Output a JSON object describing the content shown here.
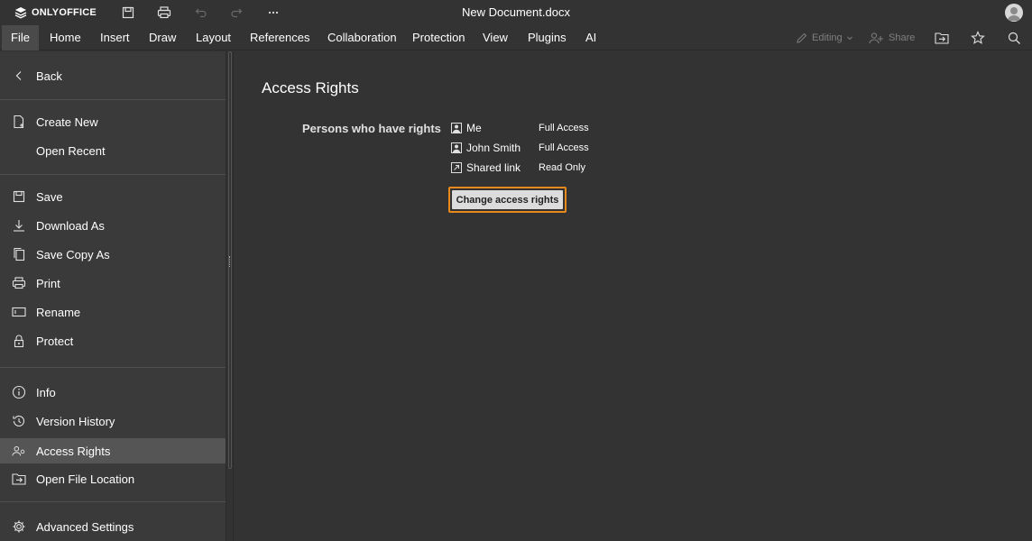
{
  "app": {
    "brand": "ONLYOFFICE",
    "document_title": "New Document.docx"
  },
  "menu_tabs": [
    {
      "label": "File",
      "active": true
    },
    {
      "label": "Home"
    },
    {
      "label": "Insert"
    },
    {
      "label": "Draw"
    },
    {
      "label": "Layout"
    },
    {
      "label": "References"
    },
    {
      "label": "Collaboration"
    },
    {
      "label": "Protection"
    },
    {
      "label": "View"
    },
    {
      "label": "Plugins"
    },
    {
      "label": "AI"
    }
  ],
  "toolbar_right": {
    "editing_label": "Editing",
    "share_label": "Share"
  },
  "file_menu": {
    "back": "Back",
    "create_new": "Create New",
    "open_recent": "Open Recent",
    "save": "Save",
    "download_as": "Download As",
    "save_copy_as": "Save Copy As",
    "print": "Print",
    "rename": "Rename",
    "protect": "Protect",
    "info": "Info",
    "version_history": "Version History",
    "access_rights": "Access Rights",
    "open_file_location": "Open File Location",
    "advanced_settings": "Advanced Settings",
    "active_item": "Access Rights"
  },
  "access_rights": {
    "title": "Access Rights",
    "persons_label": "Persons who have rights",
    "persons": [
      {
        "name": "Me",
        "access": "Full Access",
        "icon": "user-icon"
      },
      {
        "name": "John Smith",
        "access": "Full Access",
        "icon": "user-icon"
      },
      {
        "name": "Shared link",
        "access": "Read Only",
        "icon": "external-link-icon"
      }
    ],
    "change_button": "Change access rights"
  },
  "colors": {
    "background": "#333333",
    "menu_background": "#3a3a3a",
    "active_item": "#555555",
    "focus_border": "#e8891c"
  }
}
